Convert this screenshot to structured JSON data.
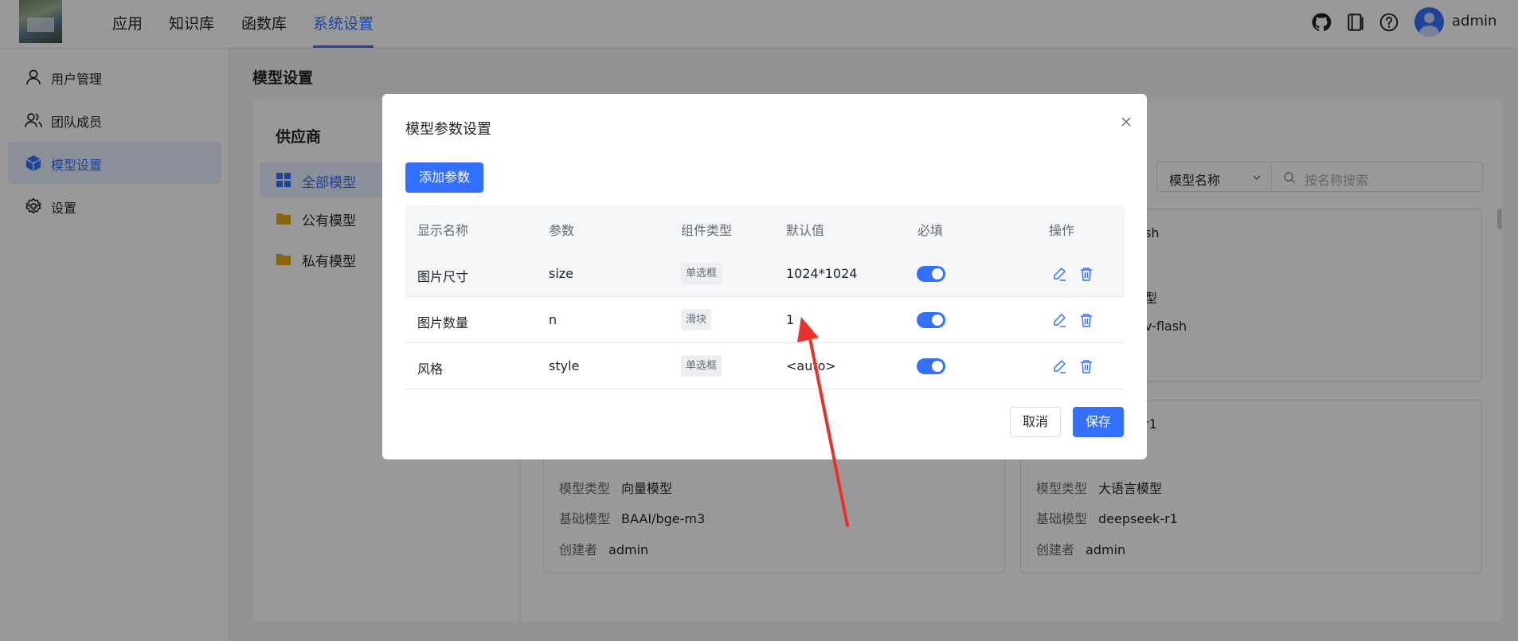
{
  "topnav": {
    "tabs": [
      {
        "label": "应用",
        "active": false
      },
      {
        "label": "知识库",
        "active": false
      },
      {
        "label": "函数库",
        "active": false
      },
      {
        "label": "系统设置",
        "active": true
      }
    ],
    "icons": [
      "github-icon",
      "book-icon",
      "help-icon"
    ],
    "username": "admin"
  },
  "sidebar": {
    "items": [
      {
        "label": "用户管理",
        "icon": "user-icon",
        "active": false
      },
      {
        "label": "团队成员",
        "icon": "team-icon",
        "active": false
      },
      {
        "label": "模型设置",
        "icon": "cube-icon",
        "active": true
      },
      {
        "label": "设置",
        "icon": "gear-icon",
        "active": false,
        "expandable": true
      }
    ]
  },
  "page": {
    "title": "模型设置"
  },
  "providers": {
    "title": "供应商",
    "items": [
      {
        "label": "全部模型",
        "icon": "grid-icon",
        "active": true
      },
      {
        "label": "公有模型",
        "icon": "folder-icon",
        "active": false
      },
      {
        "label": "私有模型",
        "icon": "folder-icon",
        "active": false
      }
    ]
  },
  "filter": {
    "select_value": "模型名称",
    "search_placeholder": "按名称搜索"
  },
  "cards": {
    "right_top": {
      "fragments": [
        "sh",
        "型",
        "v-flash"
      ]
    },
    "left_bottom": {
      "rows": [
        {
          "key": "模型类型",
          "value": "向量模型"
        },
        {
          "key": "基础模型",
          "value": "BAAI/bge-m3"
        },
        {
          "key": "创建者",
          "value": "admin"
        }
      ]
    },
    "right_bottom": {
      "fragment": "r1",
      "rows": [
        {
          "key": "模型类型",
          "value": "大语言模型"
        },
        {
          "key": "基础模型",
          "value": "deepseek-r1"
        },
        {
          "key": "创建者",
          "value": "admin"
        }
      ]
    }
  },
  "modal": {
    "title": "模型参数设置",
    "add_button": "添加参数",
    "columns": [
      "显示名称",
      "参数",
      "组件类型",
      "默认值",
      "必填",
      "操作"
    ],
    "rows": [
      {
        "name": "图片尺寸",
        "param": "size",
        "component": "单选框",
        "default": "1024*1024",
        "required": true
      },
      {
        "name": "图片数量",
        "param": "n",
        "component": "滑块",
        "default": "1",
        "required": true
      },
      {
        "name": "风格",
        "param": "style",
        "component": "单选框",
        "default": "<auto>",
        "required": true
      }
    ],
    "cancel_button": "取消",
    "save_button": "保存"
  },
  "colors": {
    "accent": "#3370ff",
    "annotation_arrow": "#e8322d"
  }
}
